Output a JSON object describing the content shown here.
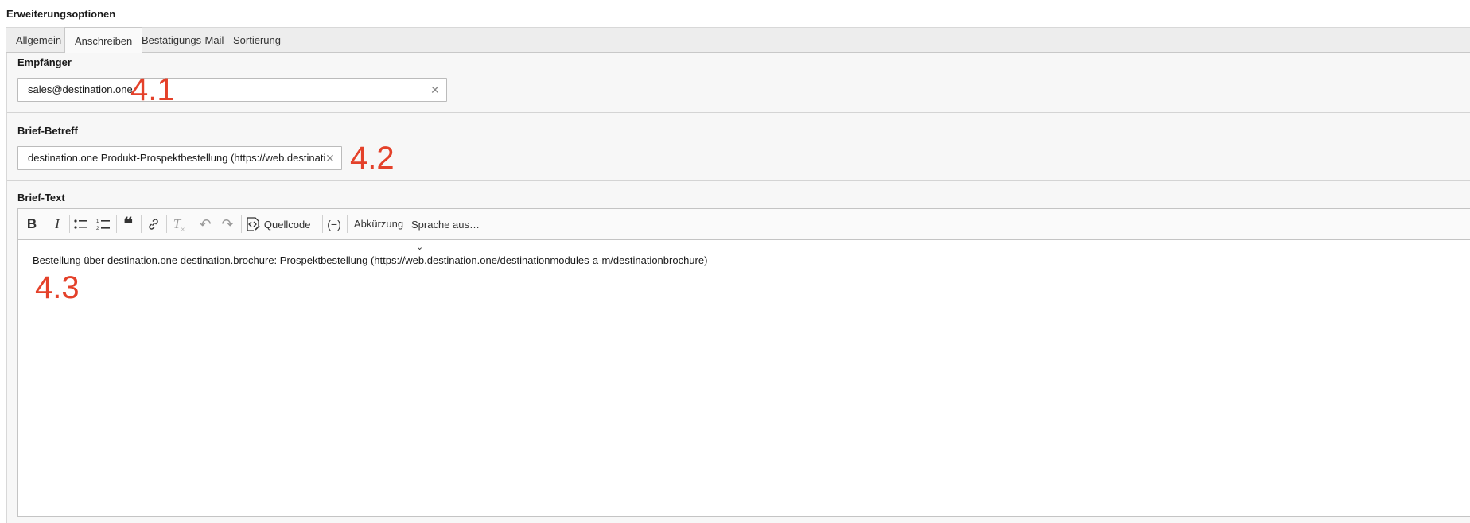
{
  "page": {
    "title": "Erweiterungsoptionen"
  },
  "tabs": [
    {
      "label": "Allgemein"
    },
    {
      "label": "Anschreiben",
      "active": true
    },
    {
      "label": "Bestätigungs-Mail"
    },
    {
      "label": "Sortierung"
    }
  ],
  "fields": {
    "recipient": {
      "label": "Empfänger",
      "value": "sales@destination.one"
    },
    "subject": {
      "label": "Brief-Betreff",
      "value": "destination.one Produkt-Prospektbestellung (https://web.destination.one"
    },
    "body": {
      "label": "Brief-Text",
      "content": "Bestellung über destination.one destination.brochure: Prospektbestellung (https://web.destination.one/destinationmodules-a-m/destinationbrochure)"
    }
  },
  "toolbar": {
    "bold": "B",
    "italic": "I",
    "source_label": "Quellcode",
    "soft_hyphen": "(−)",
    "abbreviation_label": "Abkürzung",
    "language_label": "Sprache aus…"
  },
  "annotations": {
    "a1": "4.1",
    "a2": "4.2",
    "a3": "4.3"
  },
  "colors": {
    "annotation": "#e4412a"
  }
}
